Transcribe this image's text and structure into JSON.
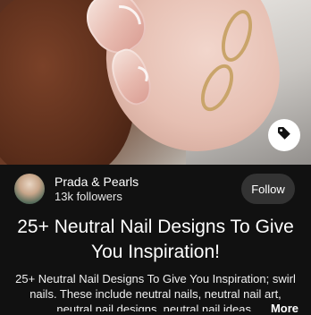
{
  "pin": {
    "image_alt": "Neutral swirl nail design",
    "tag_icon": "tag-icon"
  },
  "creator": {
    "name": "Prada & Pearls",
    "followers": "13k followers",
    "follow_label": "Follow"
  },
  "title": "25+ Neutral Nail Designs To Give You Inspiration!",
  "description": "25+ Neutral Nail Designs To Give You Inspiration; swirl nails. These include neutral nails, neutral nail art, neutral nail designs, neutral nail ideas,",
  "more_label": "More"
}
